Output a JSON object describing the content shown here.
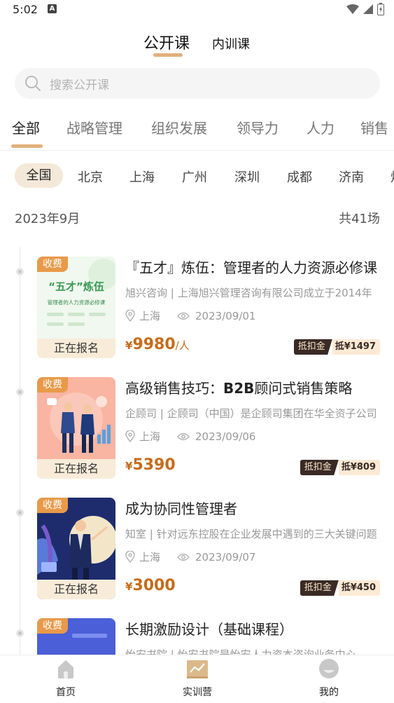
{
  "status": {
    "time": "5:02",
    "notif": "A"
  },
  "top_tabs": {
    "public": "公开课",
    "internal": "内训课"
  },
  "search": {
    "placeholder": "搜索公开课"
  },
  "categories": [
    "全部",
    "战略管理",
    "组织发展",
    "领导力",
    "人力",
    "销售"
  ],
  "cities": [
    "全国",
    "北京",
    "上海",
    "广州",
    "深圳",
    "成都",
    "济南",
    "烟"
  ],
  "month": {
    "label": "2023年9月",
    "count": "共41场"
  },
  "courses": [
    {
      "badge": "收费",
      "status": "正在报名",
      "title": "『五才』炼伍：管理者的人力资源必修课",
      "subtitle": "旭兴咨询 | 上海旭兴管理咨询有限公司成立于2014年",
      "location": "上海",
      "date": "2023/09/01",
      "price_symbol": "¥",
      "price": "9980",
      "price_unit": "/人",
      "deduct_tag": "抵扣金",
      "deduct_value": "抵¥1497",
      "thumb_text": "“五才”炼伍",
      "thumb_sub": "管理者的人力资源必修课"
    },
    {
      "badge": "收费",
      "status": "正在报名",
      "title_plain": "高级销售技巧：",
      "title_bold": "B2B",
      "title_rest": "顾问式销售策略",
      "subtitle": "企顾司 | 企顾司（中国）是企顾司集团在华全资子公司",
      "location": "上海",
      "date": "2023/09/06",
      "price_symbol": "¥",
      "price": "5390",
      "price_unit": "",
      "deduct_tag": "抵扣金",
      "deduct_value": "抵¥809"
    },
    {
      "badge": "收费",
      "status": "正在报名",
      "title": "成为协同性管理者",
      "subtitle": "知室 | 针对远东控股在企业发展中遇到的三大关键问题",
      "location": "上海",
      "date": "2023/09/07",
      "price_symbol": "¥",
      "price": "3000",
      "price_unit": "",
      "deduct_tag": "抵扣金",
      "deduct_value": "抵¥450"
    },
    {
      "badge": "收费",
      "title": "长期激励设计（基础课程）",
      "subtitle": "怡安书院 | 怡安书院是怡安人力资本咨询业务中心"
    }
  ],
  "bottom_nav": {
    "home": "首页",
    "camp": "实训营",
    "mine": "我的"
  },
  "colors": {
    "accent": "#e1b07c",
    "price": "#c76b19",
    "badge": "#e89a4a"
  }
}
